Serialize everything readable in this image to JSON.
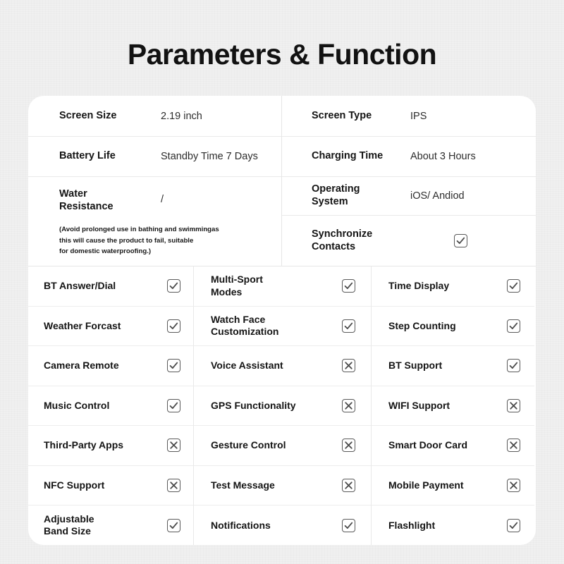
{
  "page": {
    "title": "Parameters & Function",
    "background_color": "#f0f0f0",
    "card_color": "#ffffff",
    "text_color": "#141414"
  },
  "specs": {
    "left": [
      {
        "label": "Screen Size",
        "value": "2.19 inch"
      },
      {
        "label": "Battery Life",
        "value": "Standby Time 7 Days"
      },
      {
        "label": "Water Resistance",
        "label_line1": "Water",
        "label_line2": "Resistance",
        "value": "/",
        "note_line1": "(Avoid prolonged use in bathing and swimmingas",
        "note_line2": "this will cause the product to fail, suitable",
        "note_line3": "for domestic waterproofing.)"
      }
    ],
    "right": [
      {
        "label": "Screen Type",
        "value": "IPS"
      },
      {
        "label": "Charging Time",
        "value": "About 3 Hours"
      },
      {
        "label": "Operating System",
        "label_line1": "Operating",
        "label_line2": "System",
        "value": "iOS/ Andiod"
      },
      {
        "label": "Synchronize Contacts",
        "label_line1": "Synchronize",
        "label_line2": "Contacts",
        "state": "check",
        "icon": "checkbox-checked-icon"
      }
    ]
  },
  "features": {
    "column1": [
      {
        "label": "BT Answer/Dial",
        "state": "check",
        "icon": "checkbox-checked-icon"
      },
      {
        "label": "Weather Forcast",
        "state": "check",
        "icon": "checkbox-checked-icon"
      },
      {
        "label": "Camera Remote",
        "state": "check",
        "icon": "checkbox-checked-icon"
      },
      {
        "label": "Music Control",
        "state": "check",
        "icon": "checkbox-checked-icon"
      },
      {
        "label": "Third-Party Apps",
        "state": "cross",
        "icon": "checkbox-crossed-icon"
      },
      {
        "label": "NFC Support",
        "state": "cross",
        "icon": "checkbox-crossed-icon"
      },
      {
        "label": "Adjustable Band Size",
        "label_line1": "Adjustable",
        "label_line2": "Band Size",
        "state": "check",
        "icon": "checkbox-checked-icon"
      }
    ],
    "column2": [
      {
        "label": "Multi-Sport Modes",
        "label_line1": "Multi-Sport",
        "label_line2": "Modes",
        "state": "check",
        "icon": "checkbox-checked-icon"
      },
      {
        "label": "Watch Face Customization",
        "label_line1": "Watch Face",
        "label_line2": "Customization",
        "state": "check",
        "icon": "checkbox-checked-icon"
      },
      {
        "label": "Voice Assistant",
        "state": "cross",
        "icon": "checkbox-crossed-icon"
      },
      {
        "label": "GPS Functionality",
        "state": "cross",
        "icon": "checkbox-crossed-icon"
      },
      {
        "label": "Gesture Control",
        "state": "cross",
        "icon": "checkbox-crossed-icon"
      },
      {
        "label": "Test Message",
        "state": "cross",
        "icon": "checkbox-crossed-icon"
      },
      {
        "label": "Notifications",
        "state": "check",
        "icon": "checkbox-checked-icon"
      }
    ],
    "column3": [
      {
        "label": "Time Display",
        "state": "check",
        "icon": "checkbox-checked-icon"
      },
      {
        "label": "Step Counting",
        "state": "check",
        "icon": "checkbox-checked-icon"
      },
      {
        "label": "BT Support",
        "state": "check",
        "icon": "checkbox-checked-icon"
      },
      {
        "label": "WIFI Support",
        "state": "cross",
        "icon": "checkbox-crossed-icon"
      },
      {
        "label": "Smart Door Card",
        "state": "cross",
        "icon": "checkbox-crossed-icon"
      },
      {
        "label": "Mobile Payment",
        "state": "cross",
        "icon": "checkbox-crossed-icon"
      },
      {
        "label": "Flashlight",
        "state": "check",
        "icon": "checkbox-checked-icon"
      }
    ]
  }
}
